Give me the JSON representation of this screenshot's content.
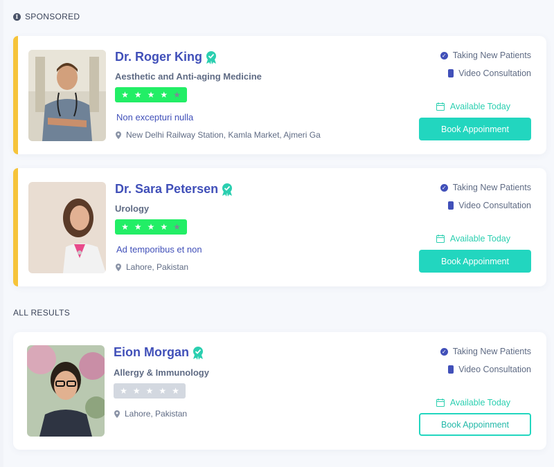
{
  "sections": {
    "sponsored_label": "SPONSORED",
    "all_results_label": "ALL RESULTS"
  },
  "colors": {
    "accent_blue": "#4150b9",
    "teal": "#22d6bf",
    "sponsored_bar": "#f6c43a",
    "rating_green": "#22ee66",
    "rating_grey": "#d3d8e0"
  },
  "doctors": [
    {
      "name": "Dr. Roger King",
      "specialty": "Aesthetic and Anti-aging Medicine",
      "rating": 4,
      "rating_max": 5,
      "tagline": "Non excepturi nulla",
      "location": "New Delhi Railway Station, Kamla Market, Ajmeri Ga",
      "features": [
        "Taking New Patients",
        "Video Consultation"
      ],
      "availability": "Available Today",
      "book_label": "Book Appoinment",
      "sponsored": true
    },
    {
      "name": "Dr. Sara Petersen",
      "specialty": "Urology",
      "rating": 4,
      "rating_max": 5,
      "tagline": "Ad temporibus et non",
      "location": "Lahore, Pakistan",
      "features": [
        "Taking New Patients",
        "Video Consultation"
      ],
      "availability": "Available Today",
      "book_label": "Book Appoinment",
      "sponsored": true
    },
    {
      "name": "Eion Morgan",
      "specialty": "Allergy & Immunology",
      "rating": 0,
      "rating_max": 5,
      "location": "Lahore, Pakistan",
      "features": [
        "Taking New Patients",
        "Video Consultation"
      ],
      "availability": "Available Today",
      "book_label": "Book Appoinment",
      "sponsored": false
    }
  ]
}
